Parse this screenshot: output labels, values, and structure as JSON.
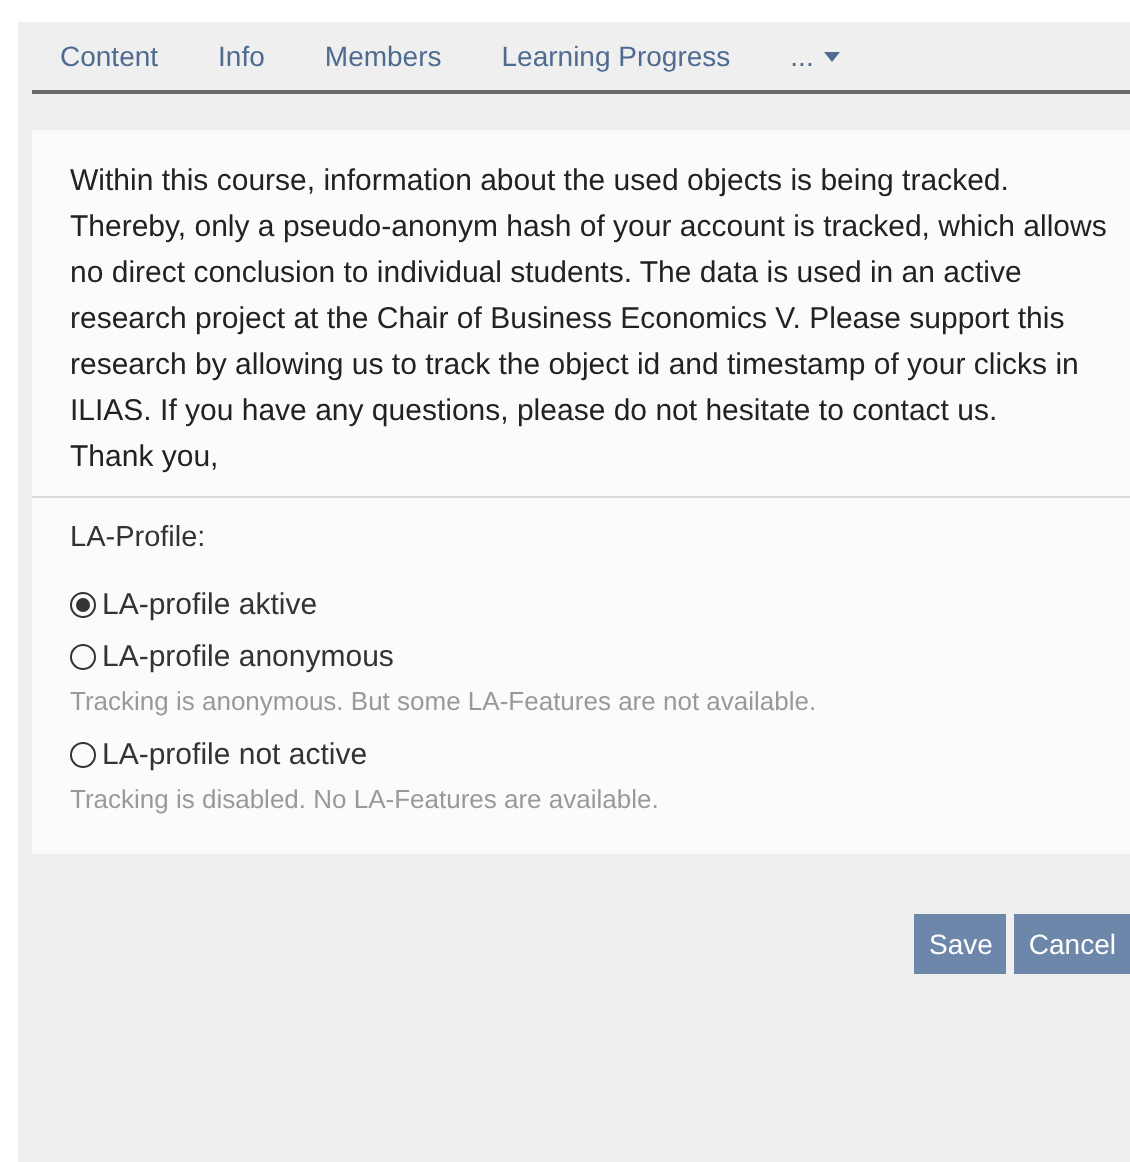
{
  "tabs": [
    {
      "label": "Content",
      "selected": false
    },
    {
      "label": "Info",
      "selected": false
    },
    {
      "label": "Members",
      "selected": false
    },
    {
      "label": "Learning Progress",
      "selected": false
    },
    {
      "label": "...",
      "kind": "more",
      "selected": false
    }
  ],
  "message": [
    "Within this course, information about the used objects is being tracked. Thereby, only a pseudo-anonym hash of your account is tracked, which allows no direct conclusion to individual students. The data is used in an active research project at the Chair of Business Economics V. Please support this research by allowing us to track the object id and timestamp of your clicks in ILIAS. If you have any questions, please do not hesitate to contact us.",
    "Thank you,"
  ],
  "profile": {
    "label": "LA-Profile:",
    "options": [
      {
        "label": "LA-profile aktive",
        "selected": true
      },
      {
        "label": "LA-profile anonymous",
        "selected": false,
        "hint": "Tracking is anonymous. But some LA-Features are not available."
      },
      {
        "label": "LA-profile not active",
        "selected": false,
        "hint": "Tracking is disabled. No LA-Features are available."
      }
    ]
  },
  "buttons": [
    "Save",
    "Cancel"
  ]
}
